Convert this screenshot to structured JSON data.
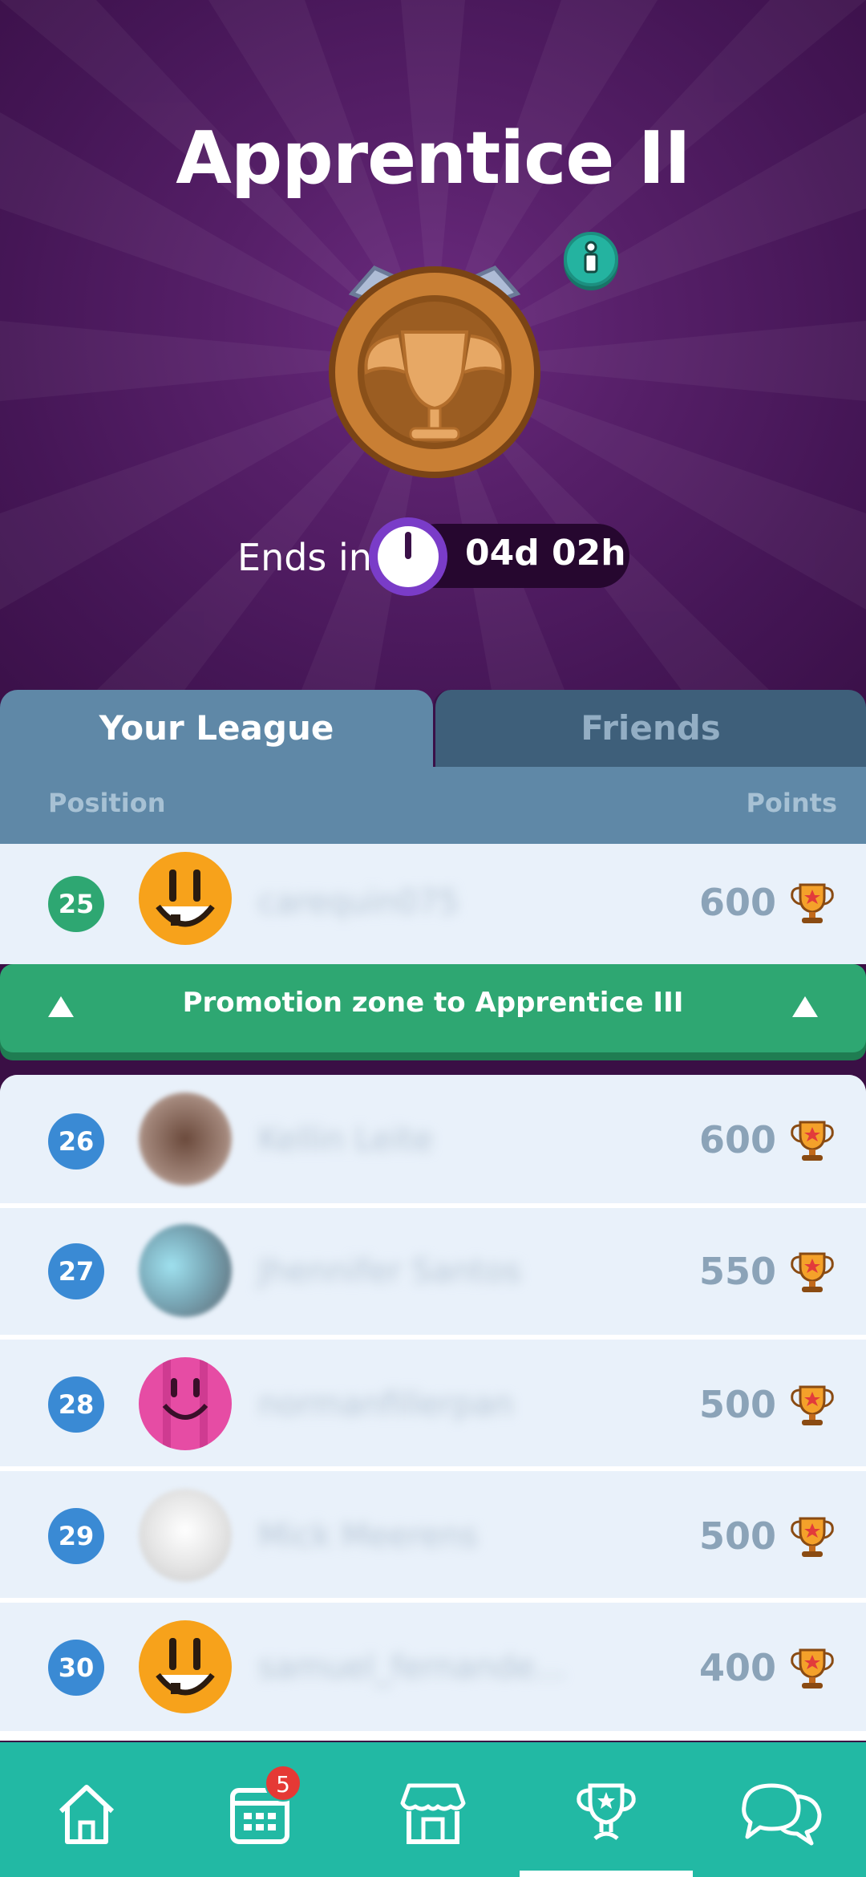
{
  "league": {
    "title": "Apprentice II",
    "ends_label": "Ends in",
    "time_left": "04d 02h"
  },
  "tabs": [
    {
      "label": "Your League",
      "active": true
    },
    {
      "label": "Friends",
      "active": false
    }
  ],
  "table_header": {
    "position": "Position",
    "points": "Points"
  },
  "current_user": {
    "position": "25",
    "name": "carequin075",
    "points": "600"
  },
  "promotion": {
    "label": "Promotion zone to Apprentice III"
  },
  "rows": [
    {
      "position": "26",
      "name": "Kellin Leite",
      "points": "600"
    },
    {
      "position": "27",
      "name": "Jhennifer Santos",
      "points": "550"
    },
    {
      "position": "28",
      "name": "normanfillerpan",
      "points": "500"
    },
    {
      "position": "29",
      "name": "Mick Meerens",
      "points": "500"
    },
    {
      "position": "30",
      "name": "samuel_fernande...",
      "points": "400"
    }
  ],
  "nav": {
    "items": [
      "home-icon",
      "calendar-icon",
      "shop-icon",
      "trophy-icon",
      "chat-icon"
    ],
    "calendar_badge": "5",
    "active": "trophy-icon"
  },
  "colors": {
    "promotion_green": "#2ea772",
    "nav_teal": "#22b9a4",
    "hero_purple": "#561f68",
    "position_blue": "#3a8ad4"
  }
}
